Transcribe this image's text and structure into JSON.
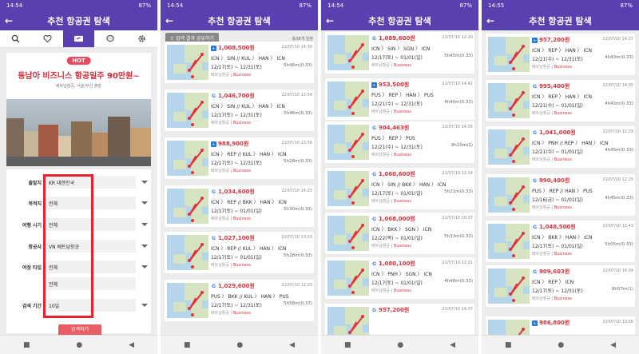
{
  "app_title": "추천 항공권 탐색",
  "status": [
    {
      "time": "14:54",
      "battery": "87%"
    },
    {
      "time": "14:54",
      "battery": "87%"
    },
    {
      "time": "14:54",
      "battery": "87%"
    },
    {
      "time": "14:55",
      "battery": "87%"
    }
  ],
  "back_glyph": "←",
  "nav": {
    "stop": "■",
    "home": "●",
    "back": "◀"
  },
  "screen1": {
    "hot_badge": "HOT",
    "promo_title": "동남아 비즈니스 항공일주 90만원~",
    "promo_subtitle": "베트남항공, 서울/부산 출발",
    "form": [
      {
        "label": "출발지",
        "value": "KR 대한민국"
      },
      {
        "label": "목적지",
        "value": "전체"
      },
      {
        "label": "여행 시기",
        "value": "전체"
      },
      {
        "label": "항공사",
        "value": "VN 베트남항공"
      },
      {
        "label": "여정 타입",
        "value": "전체"
      },
      {
        "label": "",
        "value": "전체"
      },
      {
        "label": "검색 기간",
        "value": "10일"
      }
    ],
    "search_button": "검색하기"
  },
  "screen2": {
    "share_button": "검색 결과 공유하기",
    "result_count": "총38개 일정",
    "cards": [
      {
        "logo": "box",
        "price": "1,008,500원",
        "date": "22/07/10 14:39",
        "route": "ICN 〉 SIN // KUL 〉 HAN 〉 ICN",
        "dates": "12/17(토) ~ 12/31(토)",
        "duration": "5h46m(0.33)",
        "airline": "베트남항공",
        "cabin": "Business"
      },
      {
        "logo": "G",
        "price": "1,046,700원",
        "date": "22/07/10 13:54",
        "route": "ICN 〉 SIN // KUL 〉 HAN 〉 ICN",
        "dates": "12/17(토) ~ 12/31(토)",
        "duration": "5h46m(0.33)",
        "airline": "베트남항공",
        "cabin": "Business"
      },
      {
        "logo": "box",
        "price": "988,900원",
        "date": "22/07/10 13:56",
        "route": "ICN 〉 REP // KUL 〉 HAN 〉 ICN",
        "dates": "12/17(토) ~ 12/31(토)",
        "duration": "5h28m(0.33)",
        "airline": "베트남항공",
        "cabin": "Business"
      },
      {
        "logo": "G",
        "price": "1,034,600원",
        "date": "22/07/10 14:23",
        "route": "ICN 〉 REP // BKK 〉 HAN 〉 ICN",
        "dates": "12/17(토) ~ 01/01(일)",
        "duration": "5h30m(0.33)",
        "airline": "베트남항공",
        "cabin": "Business"
      },
      {
        "logo": "G",
        "price": "1,027,100원",
        "date": "22/07/10 13:03",
        "route": "ICN 〉 REP // KUL 〉 HAN 〉 ICN",
        "dates": "12/17(토) ~ 01/01(일)",
        "duration": "5h28m(0.33)",
        "airline": "베트남항공",
        "cabin": "Business"
      },
      {
        "logo": "G",
        "price": "1,029,600원",
        "date": "22/07/10 12:23",
        "route": "PUS 〉 BKK // KUL 〉 HAN 〉 PUS",
        "dates": "12/17(토) ~ 12/31(토)",
        "duration": "5h58m(0.33)",
        "airline": "베트남항공",
        "cabin": "Business"
      }
    ]
  },
  "screen3": {
    "cards": [
      {
        "logo": "G",
        "price": "1,089,600원",
        "date": "22/07/10 12:20",
        "route": "ICN 〉 SIN 〉 SGN 〉 ICN",
        "dates": "12/17(토) ~ 01/01(일)",
        "duration": "5h45m(0.33)",
        "airline": "베트남항공",
        "cabin": "Business"
      },
      {
        "logo": "box",
        "price": "953,500원",
        "date": "22/07/10 14:42",
        "route": "PUS 〉 REP 〉 HAN 〉 PUS",
        "dates": "12/21(수) ~ 12/31(토)",
        "duration": "4h40m(0.33)",
        "airline": "베트남항공",
        "cabin": "Business"
      },
      {
        "logo": "G",
        "price": "904,463원",
        "date": "22/07/10 14:05",
        "route": "PUS 〉 REP 〉 PUS",
        "dates": "12/21(수) ~ 12/31(토)",
        "duration": "9h20m(1)",
        "airline": "베트남항공",
        "cabin": "Business"
      },
      {
        "logo": "G",
        "price": "1,060,600원",
        "date": "22/07/10 12:14",
        "route": "ICN 〉 SIN // BKK 〉 HAN 〉 ICN",
        "dates": "12/17(토) ~ 01/01(일)",
        "duration": "5h21m(0.33)",
        "airline": "베트남항공",
        "cabin": "Business"
      },
      {
        "logo": "G",
        "price": "1,068,000원",
        "date": "22/07/10 10:37",
        "route": "ICN 〉 BKK 〉 SGN 〉 ICN",
        "dates": "12/22(목) ~ 01/01(일)",
        "duration": "5h33m(0.33)",
        "airline": "베트남항공",
        "cabin": "Business"
      },
      {
        "logo": "G",
        "price": "1,080,100원",
        "date": "22/07/10 12:21",
        "route": "ICN 〉 PNH 〉 SGN 〉 ICN",
        "dates": "12/17(토) ~ 01/01(일)",
        "duration": "4h48m(0.33)",
        "airline": "베트남항공",
        "cabin": "Business"
      },
      {
        "logo": "G",
        "price": "957,200원",
        "date": "22/07/10 14:37",
        "route": "",
        "dates": "",
        "duration": "",
        "airline": "",
        "cabin": ""
      }
    ]
  },
  "screen4": {
    "cards": [
      {
        "logo": "box",
        "price": "957,200원",
        "date": "22/07/10 14:37",
        "route": "ICN 〉 REP 〉 HAN 〉 ICN",
        "dates": "12/21(수) ~ 12/31(토)",
        "duration": "4h43m(0.33)",
        "airline": "베트남항공",
        "cabin": "Business"
      },
      {
        "logo": "G",
        "price": "995,400원",
        "date": "22/07/10 14:35",
        "route": "ICN 〉 REP 〉 HAN 〉 ICN",
        "dates": "12/21(수) ~ 01/01(일)",
        "duration": "4h43m(0.33)",
        "airline": "베트남항공",
        "cabin": "Business"
      },
      {
        "logo": "G",
        "price": "1,041,000원",
        "date": "22/07/10 12:29",
        "route": "ICN 〉 PNH // REP 〉 HAN 〉 ICN",
        "dates": "12/21(수) ~ 01/01(일)",
        "duration": "4h45m(0.33)",
        "airline": "베트남항공",
        "cabin": "Business"
      },
      {
        "logo": "G",
        "price": "990,400원",
        "date": "22/07/10 12:25",
        "route": "PUS 〉 REP // HAN 〉 PUS",
        "dates": "12/16(금) ~ 01/01(일)",
        "duration": "4h45m(0.33)",
        "airline": "베트남항공",
        "cabin": "Business"
      },
      {
        "logo": "G",
        "price": "1,048,500원",
        "date": "22/07/10 12:43",
        "route": "ICN 〉 BKK 〉 HAN 〉 ICN",
        "dates": "12/17(토) ~ 01/01(일)",
        "duration": "5h05m(0.33)",
        "airline": "베트남항공",
        "cabin": "Business"
      },
      {
        "logo": "G",
        "price": "909,603원",
        "date": "22/07/10 14:34",
        "route": "ICN 〉 REP 〉 ICN",
        "dates": "12/17(토) ~ 12/31(토)",
        "duration": "8h57m(1)",
        "airline": "베트남항공",
        "cabin": "Business"
      },
      {
        "logo": "box",
        "price": "986,800원",
        "date": "22/07/10 13:56",
        "route": "",
        "dates": "",
        "duration": "",
        "airline": "",
        "cabin": ""
      }
    ]
  }
}
